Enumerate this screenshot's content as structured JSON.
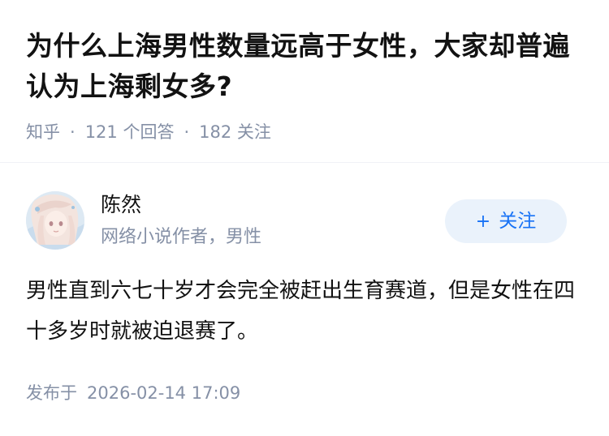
{
  "question": {
    "title": "为什么上海男性数量远高于女性，大家却普遍认为上海剩女多?",
    "source": "知乎",
    "separator": "·",
    "answer_count": "121 个回答",
    "follower_count": "182 关注"
  },
  "author": {
    "name": "陈然",
    "bio": "网络小说作者，男性",
    "avatar_icon": "anime-girl-avatar",
    "follow_plus": "+",
    "follow_label": "关注"
  },
  "answer": {
    "text": "男性直到六七十岁才会完全被赶出生育赛道，但是女性在四十多岁时就被迫退赛了。",
    "publish_label": "发布于",
    "publish_time": "2026-02-14 17:09"
  },
  "colors": {
    "primary_text": "#121212",
    "secondary_text": "#8590a6",
    "accent": "#1772f6",
    "follow_bg": "#eaf2fb"
  }
}
